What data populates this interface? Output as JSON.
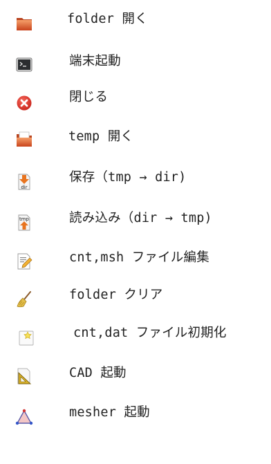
{
  "menu": {
    "items": [
      {
        "key": "folder-open",
        "label": "folder 開く",
        "icon": "folder-icon"
      },
      {
        "key": "terminal",
        "label": "端末起動",
        "icon": "terminal-icon"
      },
      {
        "key": "close",
        "label": "閉じる",
        "icon": "close-icon"
      },
      {
        "key": "temp-open",
        "label": "temp 開く",
        "icon": "temp-folder-icon"
      },
      {
        "key": "save",
        "label": "保存（tmp → dir)",
        "icon": "save-to-dir-icon"
      },
      {
        "key": "load",
        "label": "読み込み（dir → tmp)",
        "icon": "load-to-tmp-icon"
      },
      {
        "key": "edit-files",
        "label": "cnt,msh ファイル編集",
        "icon": "edit-document-icon"
      },
      {
        "key": "folder-clear",
        "label": "folder クリア",
        "icon": "broom-icon"
      },
      {
        "key": "init-files",
        "label": "cnt,dat ファイル初期化",
        "icon": "new-document-icon"
      },
      {
        "key": "cad",
        "label": "CAD 起動",
        "icon": "cad-triangle-ruler-icon"
      },
      {
        "key": "mesher",
        "label": "mesher 起動",
        "icon": "mesher-triangle-icon"
      }
    ]
  }
}
